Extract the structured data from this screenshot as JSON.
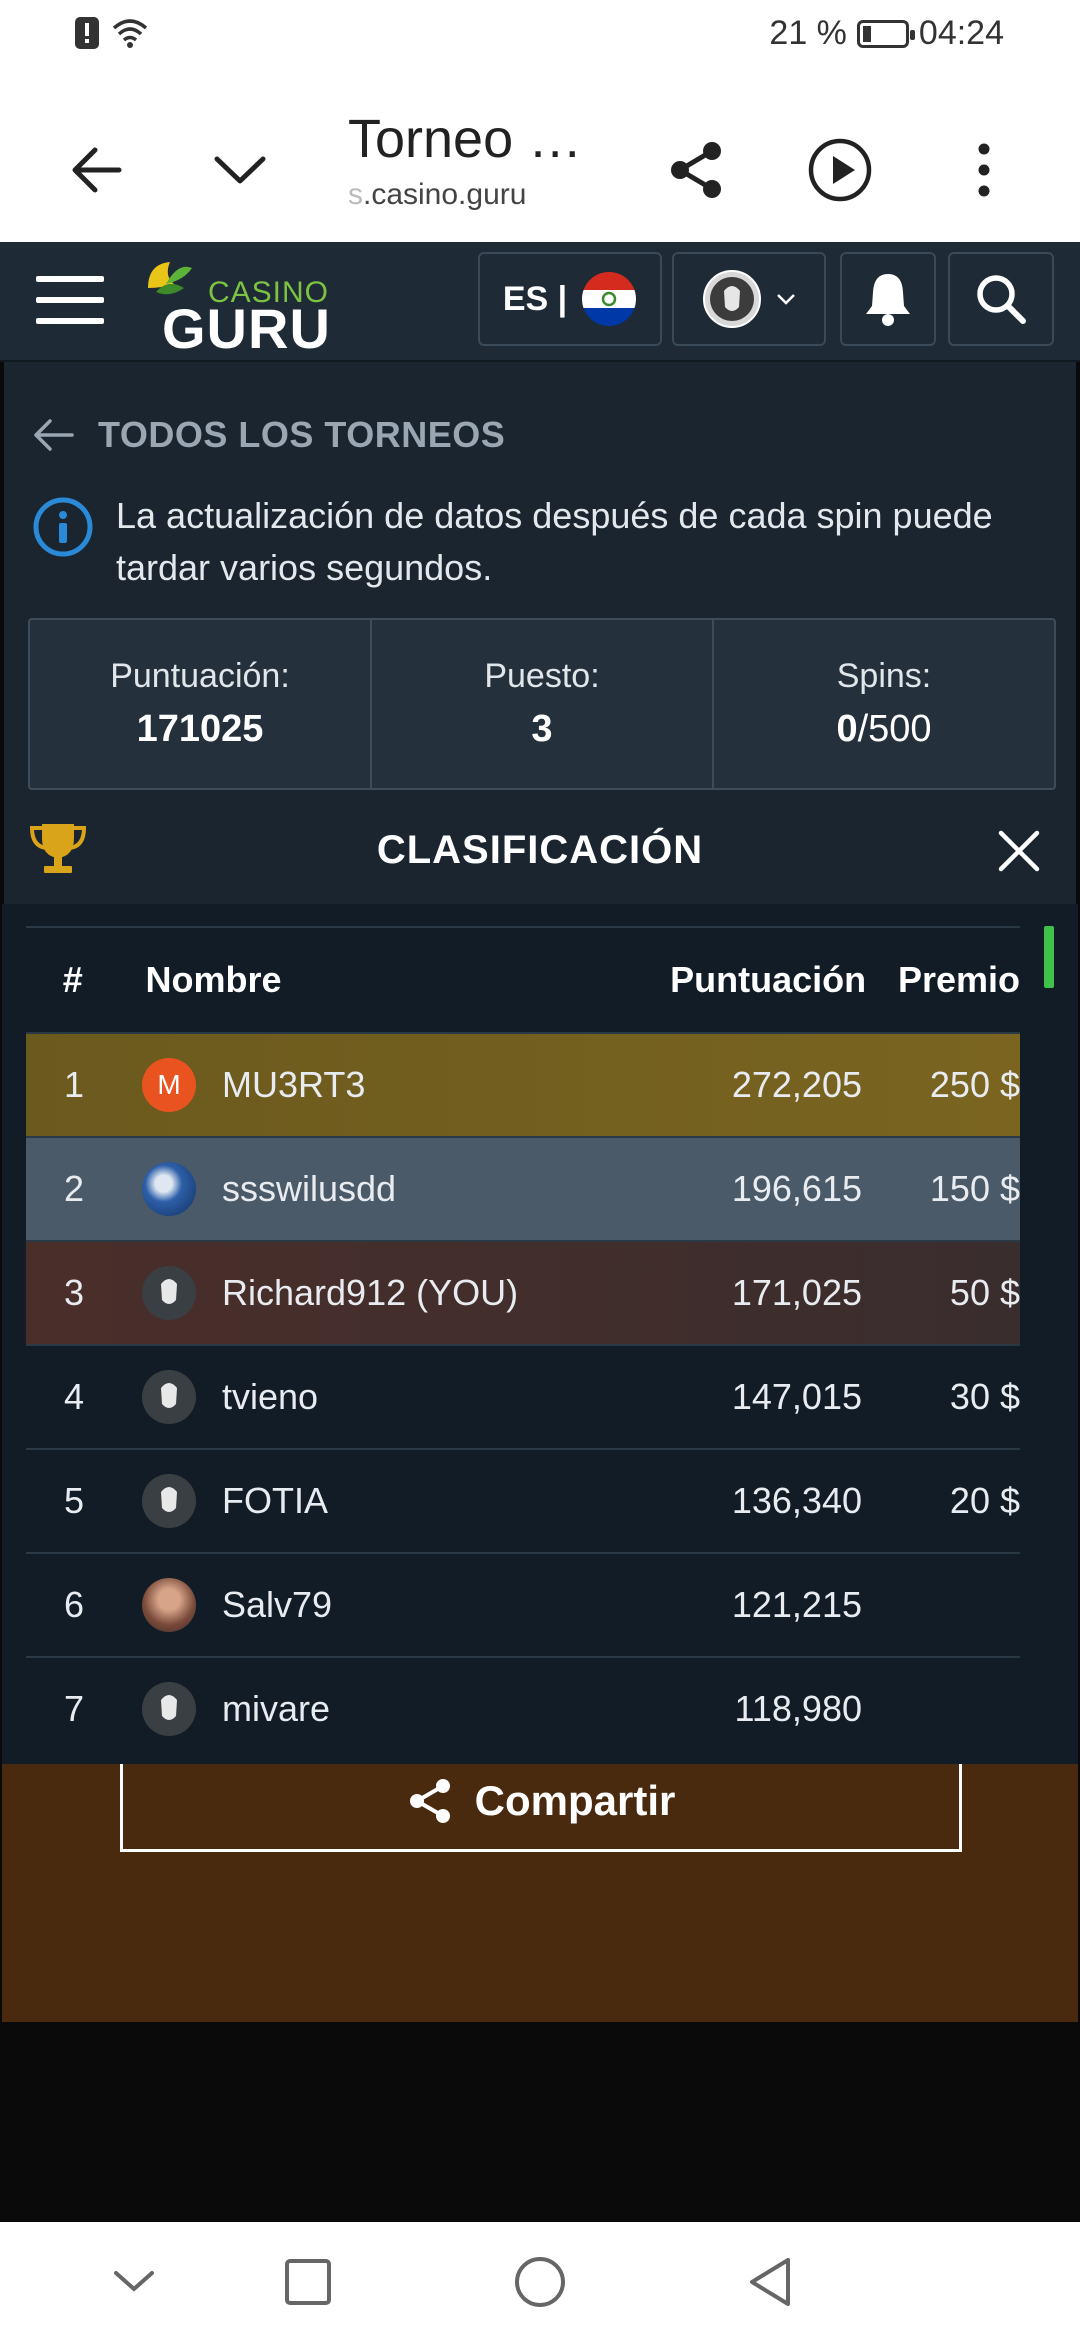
{
  "status_bar": {
    "battery_text": "21 %",
    "time": "04:24",
    "battery_level": 0.21
  },
  "browser": {
    "title": "Torneo …",
    "url_faded": "s",
    "url": ".casino.guru"
  },
  "header": {
    "logo_top": "CASINO",
    "logo_bottom": "GURU",
    "language": "ES |"
  },
  "tournament": {
    "back_label": "TODOS LOS TORNEOS",
    "info_text": "La actualización de datos después de cada spin puede tardar varios segundos.",
    "stats": {
      "score_label": "Puntuación:",
      "score_value": "171025",
      "rank_label": "Puesto:",
      "rank_value": "3",
      "spins_label": "Spins:",
      "spins_used": "0",
      "spins_total": "/500"
    },
    "classification_title": "CLASIFICACIÓN"
  },
  "leaderboard": {
    "columns": {
      "rank": "#",
      "name": "Nombre",
      "score": "Puntuación",
      "prize": "Premio"
    },
    "rows": [
      {
        "rank": "1",
        "name": "MU3RT3",
        "score": "272,205",
        "prize": "250 $",
        "avatar": "letter-M"
      },
      {
        "rank": "2",
        "name": "ssswilusdd",
        "score": "196,615",
        "prize": "150 $",
        "avatar": "photo"
      },
      {
        "rank": "3",
        "name": "Richard912 (YOU)",
        "score": "171,025",
        "prize": "50 $",
        "avatar": "default"
      },
      {
        "rank": "4",
        "name": "tvieno",
        "score": "147,015",
        "prize": "30 $",
        "avatar": "default"
      },
      {
        "rank": "5",
        "name": "FOTIA",
        "score": "136,340",
        "prize": "20 $",
        "avatar": "default"
      },
      {
        "rank": "6",
        "name": "Salv79",
        "score": "121,215",
        "prize": "",
        "avatar": "photo"
      },
      {
        "rank": "7",
        "name": "mivare",
        "score": "118,980",
        "prize": "",
        "avatar": "default"
      }
    ],
    "avatar_letter": "M"
  },
  "share_label": "Compartir",
  "colors": {
    "header_bg": "#1e2a35",
    "panel_bg": "#1a2530",
    "accent_green": "#3ec24a",
    "gold_row": "#6b5a1e",
    "silver_row": "#4a5a69",
    "bronze_row": "#4a2e2a"
  }
}
